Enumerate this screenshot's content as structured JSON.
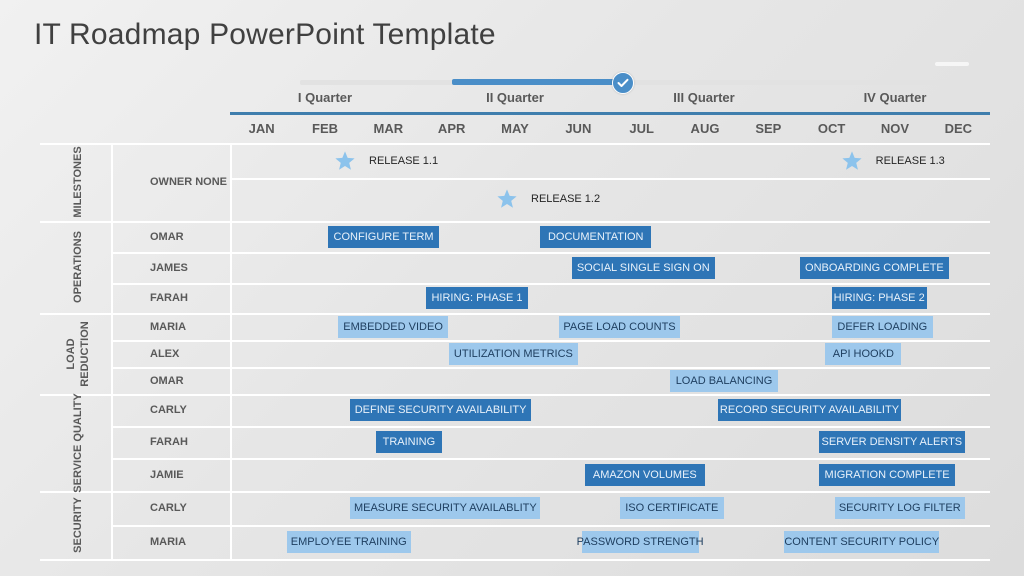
{
  "title": "IT Roadmap PowerPoint Template",
  "progress": {
    "completed_through_month": "JUN",
    "fraction_complete": 0.5,
    "icon": "check-circle-icon"
  },
  "quarters": [
    "I Quarter",
    "II Quarter",
    "III Quarter",
    "IV Quarter"
  ],
  "months": [
    "JAN",
    "FEB",
    "MAR",
    "APR",
    "MAY",
    "JUN",
    "JUL",
    "AUG",
    "SEP",
    "OCT",
    "NOV",
    "DEC"
  ],
  "groups": [
    {
      "label": "MILESTONES"
    },
    {
      "label": "OPERATIONS"
    },
    {
      "label": "LOAD REDUCTION"
    },
    {
      "label": "SERVICE QUALITY"
    },
    {
      "label": "SECURITY"
    }
  ],
  "owners": [
    {
      "name": "OWNER NONE",
      "group": "MILESTONES"
    },
    {
      "name": "OMAR",
      "group": "OPERATIONS"
    },
    {
      "name": "JAMES",
      "group": "OPERATIONS"
    },
    {
      "name": "FARAH",
      "group": "OPERATIONS"
    },
    {
      "name": "MARIA",
      "group": "LOAD REDUCTION"
    },
    {
      "name": "ALEX",
      "group": "LOAD REDUCTION"
    },
    {
      "name": "OMAR",
      "group": "LOAD REDUCTION"
    },
    {
      "name": "CARLY",
      "group": "SERVICE QUALITY"
    },
    {
      "name": "FARAH",
      "group": "SERVICE QUALITY"
    },
    {
      "name": "JAMIE",
      "group": "SERVICE QUALITY"
    },
    {
      "name": "CARLY",
      "group": "SECURITY"
    },
    {
      "name": "MARIA",
      "group": "SECURITY"
    }
  ],
  "milestones": [
    {
      "label": "RELEASE 1.1",
      "month": "FEB",
      "icon": "star-icon"
    },
    {
      "label": "RELEASE 1.2",
      "month": "MAY",
      "icon": "star-icon"
    },
    {
      "label": "RELEASE 1.3",
      "month": "OCT",
      "icon": "star-icon"
    }
  ],
  "tasks": [
    {
      "label": "CONFIGURE TERM",
      "owner_index": 1,
      "start": 1.55,
      "end": 3.3,
      "style": "dark"
    },
    {
      "label": "DOCUMENTATION",
      "owner_index": 1,
      "start": 4.9,
      "end": 6.65,
      "style": "dark"
    },
    {
      "label": "SOCIAL SINGLE SIGN ON",
      "owner_index": 2,
      "start": 5.4,
      "end": 7.65,
      "style": "dark"
    },
    {
      "label": "ONBOARDING COMPLETE",
      "owner_index": 2,
      "start": 9.0,
      "end": 11.35,
      "style": "dark"
    },
    {
      "label": "HIRING: PHASE 1",
      "owner_index": 3,
      "start": 3.1,
      "end": 4.7,
      "style": "dark"
    },
    {
      "label": "HIRING: PHASE 2",
      "owner_index": 3,
      "start": 9.5,
      "end": 11.0,
      "style": "dark"
    },
    {
      "label": "EMBEDDED VIDEO",
      "owner_index": 4,
      "start": 1.7,
      "end": 3.45,
      "style": "light"
    },
    {
      "label": "PAGE LOAD COUNTS",
      "owner_index": 4,
      "start": 5.2,
      "end": 7.1,
      "style": "light"
    },
    {
      "label": "DEFER LOADING",
      "owner_index": 4,
      "start": 9.5,
      "end": 11.1,
      "style": "light"
    },
    {
      "label": "UTILIZATION METRICS",
      "owner_index": 5,
      "start": 3.45,
      "end": 5.5,
      "style": "light"
    },
    {
      "label": "API HOOKD",
      "owner_index": 5,
      "start": 9.4,
      "end": 10.6,
      "style": "light"
    },
    {
      "label": "LOAD BALANCING",
      "owner_index": 6,
      "start": 6.95,
      "end": 8.65,
      "style": "light"
    },
    {
      "label": "DEFINE SECURITY AVAILABILITY",
      "owner_index": 7,
      "start": 1.9,
      "end": 4.75,
      "style": "dark"
    },
    {
      "label": "RECORD SECURITY AVAILABILITY",
      "owner_index": 7,
      "start": 7.7,
      "end": 10.6,
      "style": "dark"
    },
    {
      "label": "TRAINING",
      "owner_index": 8,
      "start": 2.3,
      "end": 3.35,
      "style": "dark"
    },
    {
      "label": "SERVER DENSITY ALERTS",
      "owner_index": 8,
      "start": 9.3,
      "end": 11.6,
      "style": "dark"
    },
    {
      "label": "AMAZON VOLUMES",
      "owner_index": 9,
      "start": 5.6,
      "end": 7.5,
      "style": "dark"
    },
    {
      "label": "MIGRATION COMPLETE",
      "owner_index": 9,
      "start": 9.3,
      "end": 11.45,
      "style": "dark"
    },
    {
      "label": "MEASURE SECURITY AVAILABLITY",
      "owner_index": 10,
      "start": 1.9,
      "end": 4.9,
      "style": "light"
    },
    {
      "label": "ISO CERTIFICATE",
      "owner_index": 10,
      "start": 6.15,
      "end": 7.8,
      "style": "light"
    },
    {
      "label": "SECURITY LOG FILTER",
      "owner_index": 10,
      "start": 9.55,
      "end": 11.6,
      "style": "light"
    },
    {
      "label": "EMPLOYEE TRAINING",
      "owner_index": 11,
      "start": 0.9,
      "end": 2.85,
      "style": "light"
    },
    {
      "label": "PASSWORD STRENGTH",
      "owner_index": 11,
      "start": 5.55,
      "end": 7.4,
      "style": "light"
    },
    {
      "label": "CONTENT SECURITY POLICY",
      "owner_index": 11,
      "start": 8.75,
      "end": 11.2,
      "style": "light"
    }
  ],
  "colors": {
    "dark_bar": "#2e75b6",
    "light_bar": "#9dc8ec",
    "accent": "#3f7ead",
    "star": "#8cc3ec"
  }
}
